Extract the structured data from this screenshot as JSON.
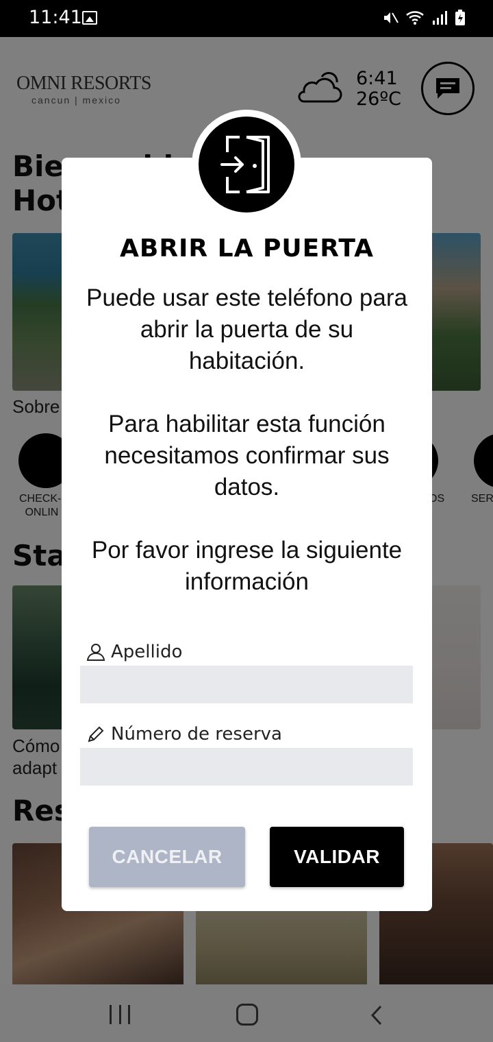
{
  "status_bar": {
    "time": "11:41"
  },
  "header": {
    "logo_main": "OMNI RESORTS",
    "logo_sub": "cancun | mexico",
    "weather_time": "6:41",
    "weather_temp": "26ºC"
  },
  "background": {
    "greeting_line1": "Bienvenido",
    "greeting_line2": "Hot",
    "about_link": "Sobre",
    "checkin_label_1": "CHECK-I",
    "checkin_label_2": "ONLIN",
    "label_right": "OS",
    "label_far_right": "SER",
    "stay_heading": "Stay",
    "stay_caption_1": "Cómo",
    "stay_caption_2": "adapt",
    "restaurants_heading": "Res"
  },
  "modal": {
    "title": "ABRIR LA PUERTA",
    "paragraph1": "Puede usar este teléfono para abrir la puerta de su habitación.",
    "paragraph2": "Para habilitar esta función necesitamos confirmar sus datos.",
    "paragraph3": "Por favor ingrese la siguiente información",
    "surname_label": "Apellido",
    "surname_value": "",
    "reservation_label": "Número de reserva",
    "reservation_value": "",
    "cancel_label": "CANCELAR",
    "validate_label": "VALIDAR"
  },
  "colors": {
    "cancel_button": "#aeb5c6",
    "validate_button": "#000000",
    "input_bg": "#e8e9ec"
  }
}
